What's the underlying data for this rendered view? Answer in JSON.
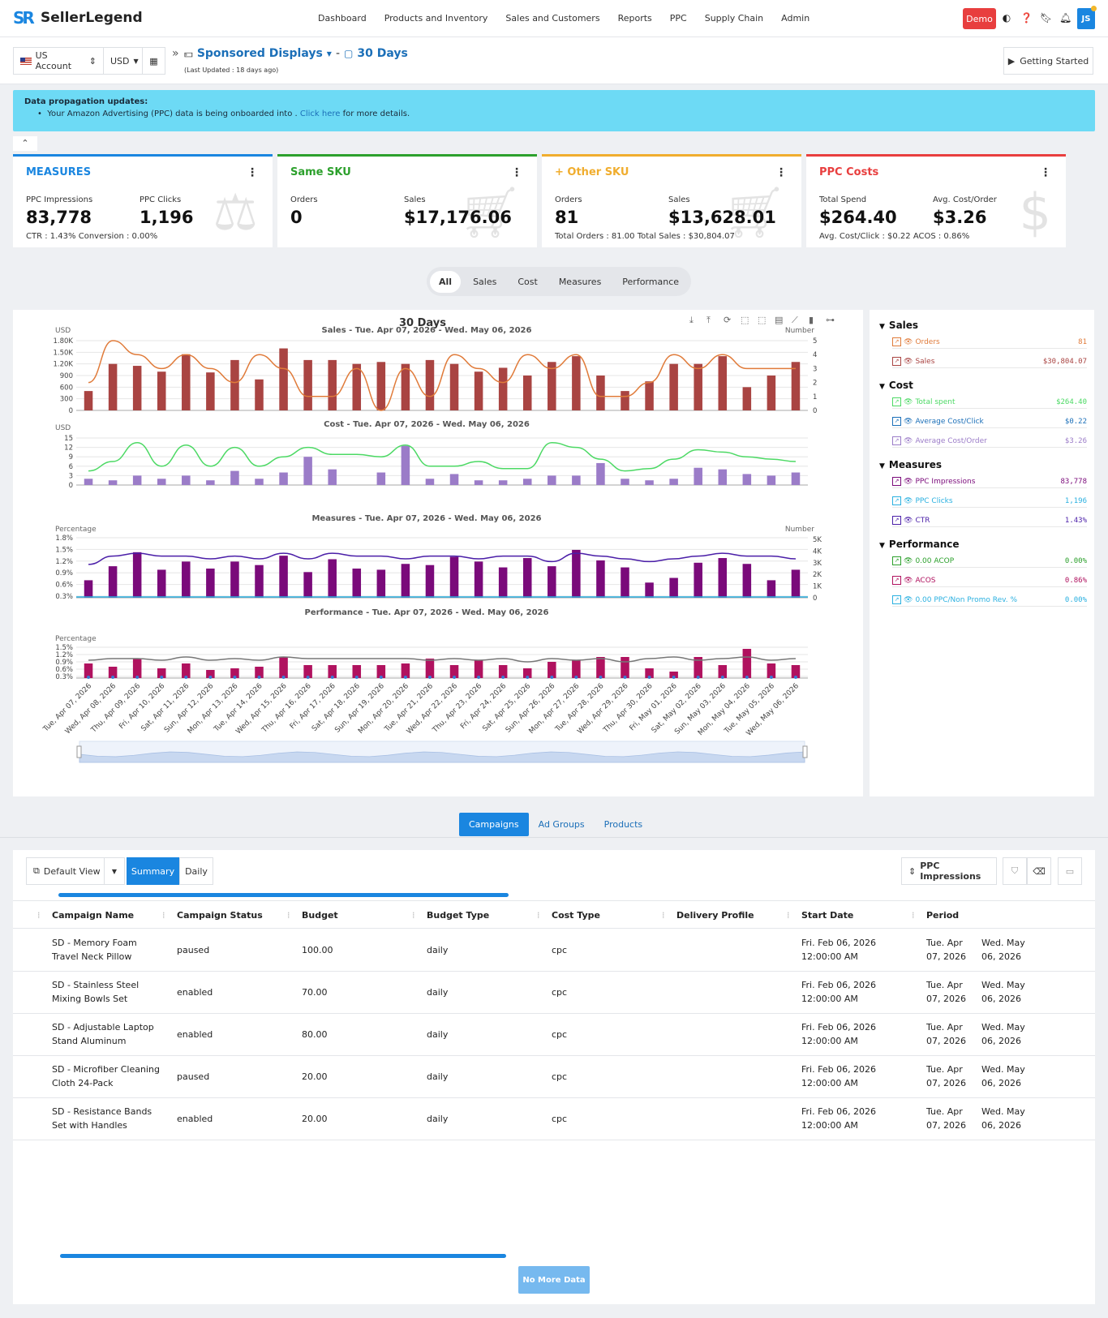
{
  "app": {
    "logo": "SR",
    "name": "SellerLegend"
  },
  "nav": [
    "Dashboard",
    "Products and Inventory",
    "Sales and Customers",
    "Reports",
    "PPC",
    "Supply Chain",
    "Admin"
  ],
  "topbar": {
    "demo": "Demo",
    "avatar": "JS"
  },
  "subheader": {
    "account": "US Account",
    "currency": "USD",
    "title": "Sponsored Displays",
    "separator": "-",
    "period": "30 Days",
    "updated": "(Last Updated : 18 days ago)",
    "getting_started": "Getting Started"
  },
  "alert": {
    "title": "Data propagation updates:",
    "text": "Your Amazon Advertising (PPC) data is being onboarded into .",
    "link": "Click here",
    "text2": "for more details."
  },
  "cards": [
    {
      "title": "MEASURES",
      "color": "#1a86e0",
      "l1": "PPC Impressions",
      "v1": "83,778",
      "l2": "PPC Clicks",
      "v2": "1,196",
      "foot": "CTR : 1.43% Conversion : 0.00%",
      "icon": "scale-icon"
    },
    {
      "title": "Same SKU",
      "color": "#2ca02c",
      "l1": "Orders",
      "v1": "0",
      "l2": "Sales",
      "v2": "$17,176.06",
      "foot": "",
      "icon": "cart-icon"
    },
    {
      "title": "+ Other SKU",
      "color": "#f0ad2e",
      "l1": "Orders",
      "v1": "81",
      "l2": "Sales",
      "v2": "$13,628.01",
      "foot": "Total Orders : 81.00 Total Sales : $30,804.07",
      "icon": "cart-plus-icon"
    },
    {
      "title": "PPC Costs",
      "color": "#e83e3e",
      "l1": "Total Spend",
      "v1": "$264.40",
      "l2": "Avg. Cost/Order",
      "v2": "$3.26",
      "foot": "Avg. Cost/Click : $0.22 ACOS : 0.86%",
      "icon": "dollar-icon"
    }
  ],
  "segments": [
    "All",
    "Sales",
    "Cost",
    "Measures",
    "Performance"
  ],
  "chart_data": {
    "type": "bar",
    "title": "30 Days",
    "categories": [
      "Tue, Apr 07, 2026",
      "Wed, Apr 08, 2026",
      "Thu, Apr 09, 2026",
      "Fri, Apr 10, 2026",
      "Sat, Apr 11, 2026",
      "Sun, Apr 12, 2026",
      "Mon, Apr 13, 2026",
      "Tue, Apr 14, 2026",
      "Wed, Apr 15, 2026",
      "Thu, Apr 16, 2026",
      "Fri, Apr 17, 2026",
      "Sat, Apr 18, 2026",
      "Sun, Apr 19, 2026",
      "Mon, Apr 20, 2026",
      "Tue, Apr 21, 2026",
      "Wed, Apr 22, 2026",
      "Thu, Apr 23, 2026",
      "Fri, Apr 24, 2026",
      "Sat, Apr 25, 2026",
      "Sun, Apr 26, 2026",
      "Mon, Apr 27, 2026",
      "Tue, Apr 28, 2026",
      "Wed, Apr 29, 2026",
      "Thu, Apr 30, 2026",
      "Fri, May 01, 2026",
      "Sat, May 02, 2026",
      "Sun, May 03, 2026",
      "Mon, May 04, 2026",
      "Tue, May 05, 2026",
      "Wed, May 06, 2026"
    ],
    "panels": [
      {
        "title": "Sales - Tue. Apr 07, 2026 - Wed. May 06, 2026",
        "left_label": "USD",
        "right_label": "Number",
        "left_ticks": [
          "1.80K",
          "1.50K",
          "1.20K",
          "900",
          "600",
          "300",
          "0"
        ],
        "right_ticks": [
          "5",
          "4",
          "3",
          "2",
          "1",
          "0"
        ],
        "left_max": 1800,
        "right_max": 5,
        "bars": {
          "name": "Sales",
          "color": "#a94442",
          "values": [
            500,
            1200,
            1150,
            1000,
            1450,
            980,
            1300,
            800,
            1600,
            1300,
            1300,
            1200,
            1250,
            1200,
            1300,
            1200,
            1000,
            1100,
            900,
            1250,
            1400,
            900,
            500,
            750,
            1200,
            1200,
            1400,
            600,
            900,
            1250,
            1300
          ]
        },
        "line": {
          "name": "Orders",
          "color": "#e07b3a",
          "values": [
            2,
            5,
            4,
            3,
            4,
            3,
            2,
            4,
            3,
            1,
            1,
            3,
            0,
            3,
            1,
            4,
            3,
            2,
            4,
            3,
            4,
            1,
            1,
            2,
            4,
            3,
            4,
            3,
            3,
            3
          ]
        }
      },
      {
        "title": "Cost - Tue. Apr 07, 2026 - Wed. May 06, 2026",
        "left_label": "USD",
        "right_label": "",
        "left_ticks": [
          "15",
          "12",
          "9",
          "6",
          "3",
          "0"
        ],
        "right_ticks": [],
        "left_max": 15,
        "right_max": 1,
        "bars": {
          "name": "Total spent",
          "color": "#9b7cc8",
          "values": [
            2,
            1.5,
            3,
            2,
            3,
            1.5,
            4.5,
            2,
            4,
            9,
            5,
            0,
            4,
            12.5,
            2,
            3.5,
            1.5,
            1.5,
            2,
            3,
            3,
            7,
            2,
            1.5,
            2,
            5.5,
            5,
            3.5,
            3,
            4
          ]
        },
        "line": {
          "name": "Average Cost/Click",
          "color": "#4cd964",
          "values": [
            0.3,
            0.5,
            0.9,
            0.4,
            0.85,
            0.4,
            0.8,
            0.4,
            0.6,
            0.8,
            0.65,
            0.65,
            0.6,
            0.85,
            0.4,
            0.4,
            0.5,
            0.35,
            0.35,
            0.9,
            0.8,
            0.55,
            0.3,
            0.35,
            0.55,
            0.75,
            0.7,
            0.6,
            0.55,
            0.5
          ]
        }
      },
      {
        "title": "Measures - Tue. Apr 07, 2026 - Wed. May 06, 2026",
        "left_label": "Percentage",
        "right_label": "Number",
        "left_ticks": [
          "1.8%",
          "1.5%",
          "1.2%",
          "0.9%",
          "0.6%",
          "0.3%"
        ],
        "right_ticks": [
          "5K",
          "4K",
          "3K",
          "2K",
          "1K",
          "0"
        ],
        "left_max": 2.1,
        "right_max": 5000,
        "bars": {
          "name": "PPC Impressions",
          "color": "#7a0a7a",
          "values": [
            1500,
            2700,
            3900,
            2400,
            3100,
            2500,
            3100,
            2800,
            3600,
            2200,
            3300,
            2500,
            2400,
            2900,
            2800,
            3500,
            3100,
            2600,
            3400,
            2700,
            4100,
            3200,
            2600,
            1300,
            1700,
            3000,
            3400,
            2900,
            1500,
            2400,
            3700
          ]
        },
        "line": {
          "name": "CTR",
          "color": "#4b1fa8",
          "values": [
            1.2,
            1.5,
            1.6,
            1.5,
            1.5,
            1.4,
            1.5,
            1.4,
            1.6,
            1.4,
            1.6,
            1.5,
            1.5,
            1.4,
            1.5,
            1.5,
            1.4,
            1.5,
            1.5,
            1.3,
            1.6,
            1.5,
            1.4,
            1.3,
            1.4,
            1.5,
            1.6,
            1.5,
            1.5,
            1.4,
            1.5
          ]
        }
      },
      {
        "title": "Performance - Tue. Apr 07, 2026 - Wed. May 06, 2026",
        "left_label": "Percentage",
        "right_label": "",
        "left_ticks": [
          "1.5%",
          "1.2%",
          "0.9%",
          "0.6%",
          "0.3%"
        ],
        "right_ticks": [],
        "left_max": 1.8,
        "right_max": 1,
        "bars": {
          "name": "ACOS",
          "color": "#b0125f",
          "values": [
            0.9,
            0.7,
            1.2,
            0.6,
            0.9,
            0.5,
            0.6,
            0.7,
            1.3,
            0.8,
            0.8,
            0.8,
            0.8,
            0.9,
            1.2,
            0.8,
            1.1,
            0.8,
            0.6,
            1.0,
            1.1,
            1.3,
            1.3,
            0.6,
            0.4,
            1.3,
            0.8,
            1.8,
            0.9,
            0.8,
            0.7
          ]
        },
        "line": {
          "name": "Total ACOS",
          "color": "#777777",
          "values": [
            1.1,
            1.2,
            1.2,
            1.1,
            1.3,
            1.1,
            1.2,
            1.1,
            1.3,
            1.2,
            1.2,
            1.2,
            1.2,
            1.2,
            1.1,
            1.2,
            1.1,
            1.2,
            1.0,
            1.2,
            1.1,
            1.2,
            1.0,
            1.2,
            1.3,
            1.1,
            1.2,
            1.3,
            1.1,
            1.2
          ]
        }
      }
    ]
  },
  "legend": [
    {
      "group": "Sales",
      "items": [
        {
          "label": "Orders",
          "value": "81",
          "color": "#e07b3a"
        },
        {
          "label": "Sales",
          "value": "$30,804.07",
          "color": "#a94442"
        }
      ]
    },
    {
      "group": "Cost",
      "items": [
        {
          "label": "Total spent",
          "value": "$264.40",
          "color": "#4cd964"
        },
        {
          "label": "Average Cost/Click",
          "value": "$0.22",
          "color": "#1b6fb8"
        },
        {
          "label": "Average Cost/Order",
          "value": "$3.26",
          "color": "#9b7cc8"
        }
      ]
    },
    {
      "group": "Measures",
      "items": [
        {
          "label": "PPC Impressions",
          "value": "83,778",
          "color": "#7a0a7a"
        },
        {
          "label": "PPC Clicks",
          "value": "1,196",
          "color": "#2ab0e0"
        },
        {
          "label": "CTR",
          "value": "1.43%",
          "color": "#4b1fa8"
        }
      ]
    },
    {
      "group": "Performance",
      "items": [
        {
          "label": "0.00 ACOP",
          "value": "0.00%",
          "color": "#2ca02c"
        },
        {
          "label": "ACOS",
          "value": "0.86%",
          "color": "#b0125f"
        },
        {
          "label": "0.00 PPC/Non Promo Rev. %",
          "value": "0.00%",
          "color": "#2ab0e0"
        }
      ]
    }
  ],
  "tabs": [
    "Campaigns",
    "Ad Groups",
    "Products"
  ],
  "toolbar": {
    "view": "Default View",
    "summary": "Summary",
    "daily": "Daily",
    "sort": "PPC Impressions"
  },
  "table": {
    "columns": [
      "Campaign Name",
      "Campaign Status",
      "Budget",
      "Budget Type",
      "Cost Type",
      "Delivery Profile",
      "Start Date",
      "Period"
    ],
    "rows": [
      {
        "name": "SD - Memory Foam Travel Neck Pillow",
        "status": "paused",
        "budget": "100.00",
        "btype": "daily",
        "ctype": "cpc",
        "profile": "",
        "start": "Fri. Feb 06, 2026 12:00:00 AM",
        "from": "Tue. Apr 07, 2026",
        "to": "Wed. May 06, 2026"
      },
      {
        "name": "SD - Stainless Steel Mixing Bowls Set",
        "status": "enabled",
        "budget": "70.00",
        "btype": "daily",
        "ctype": "cpc",
        "profile": "",
        "start": "Fri. Feb 06, 2026 12:00:00 AM",
        "from": "Tue. Apr 07, 2026",
        "to": "Wed. May 06, 2026"
      },
      {
        "name": "SD - Adjustable Laptop Stand Aluminum",
        "status": "enabled",
        "budget": "80.00",
        "btype": "daily",
        "ctype": "cpc",
        "profile": "",
        "start": "Fri. Feb 06, 2026 12:00:00 AM",
        "from": "Tue. Apr 07, 2026",
        "to": "Wed. May 06, 2026"
      },
      {
        "name": "SD - Microfiber Cleaning Cloth 24-Pack",
        "status": "paused",
        "budget": "20.00",
        "btype": "daily",
        "ctype": "cpc",
        "profile": "",
        "start": "Fri. Feb 06, 2026 12:00:00 AM",
        "from": "Tue. Apr 07, 2026",
        "to": "Wed. May 06, 2026"
      },
      {
        "name": "SD - Resistance Bands Set with Handles",
        "status": "enabled",
        "budget": "20.00",
        "btype": "daily",
        "ctype": "cpc",
        "profile": "",
        "start": "Fri. Feb 06, 2026 12:00:00 AM",
        "from": "Tue. Apr 07, 2026",
        "to": "Wed. May 06, 2026"
      }
    ],
    "no_more": "No More Data"
  }
}
